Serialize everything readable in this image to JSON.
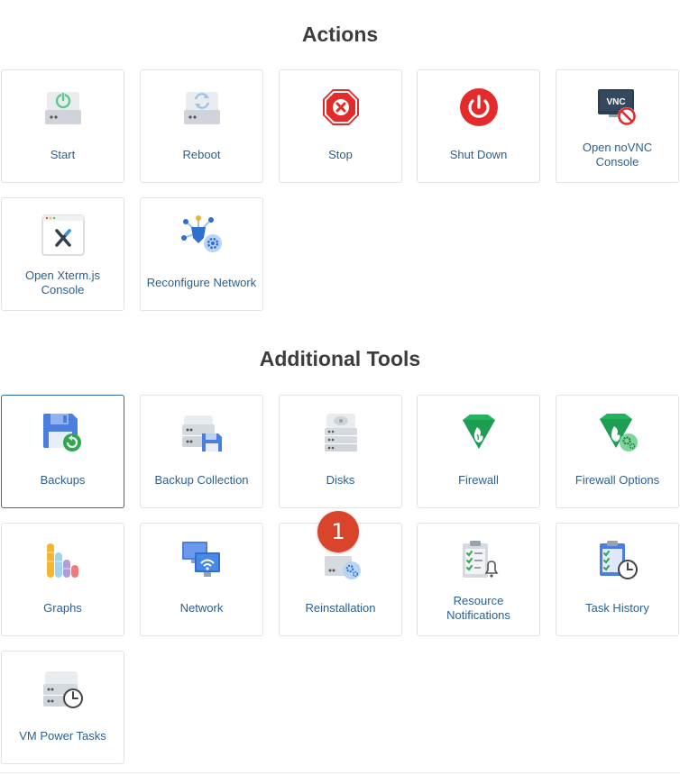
{
  "sections": {
    "actions_title": "Actions",
    "tools_title": "Additional Tools"
  },
  "actions": [
    {
      "label": "Start",
      "icon": "server-power-icon"
    },
    {
      "label": "Reboot",
      "icon": "server-reboot-icon"
    },
    {
      "label": "Stop",
      "icon": "stop-sign-icon"
    },
    {
      "label": "Shut Down",
      "icon": "power-button-icon"
    },
    {
      "label": "Open noVNC Console",
      "icon": "vnc-console-icon"
    },
    {
      "label": "Open Xterm.js Console",
      "icon": "xterm-console-icon"
    },
    {
      "label": "Reconfigure Network",
      "icon": "network-config-icon"
    }
  ],
  "tools": [
    {
      "label": "Backups",
      "icon": "floppy-backup-icon"
    },
    {
      "label": "Backup Collection",
      "icon": "server-backup-icon"
    },
    {
      "label": "Disks",
      "icon": "disks-icon"
    },
    {
      "label": "Firewall",
      "icon": "firewall-icon"
    },
    {
      "label": "Firewall Options",
      "icon": "firewall-options-icon"
    },
    {
      "label": "Graphs",
      "icon": "graphs-icon"
    },
    {
      "label": "Network",
      "icon": "network-monitors-icon"
    },
    {
      "label": "Reinstallation",
      "icon": "reinstall-icon"
    },
    {
      "label": "Resource Notifications",
      "icon": "resource-notifications-icon"
    },
    {
      "label": "Task History",
      "icon": "task-history-icon"
    },
    {
      "label": "VM Power Tasks",
      "icon": "vm-power-tasks-icon"
    }
  ],
  "badge": {
    "value": "1"
  },
  "colors": {
    "label": "#2b5f93",
    "active_border": "#2d6da3",
    "badge": "#d9442b",
    "stop": "#e32b2b",
    "firewall": "#22b35d"
  }
}
